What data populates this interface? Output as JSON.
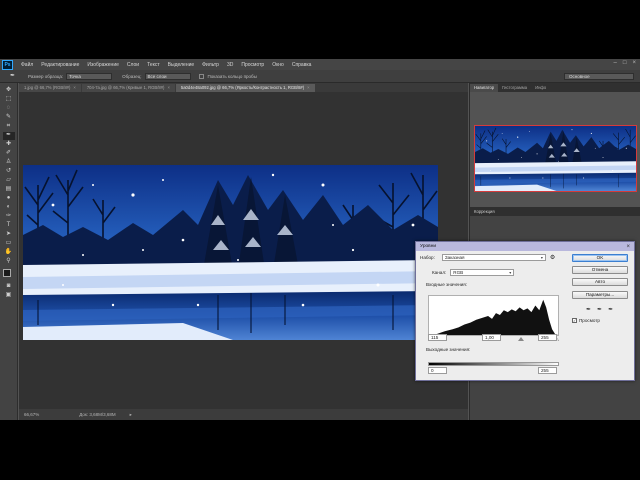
{
  "app": {
    "logo": "Ps"
  },
  "menu": [
    "Файл",
    "Редактирование",
    "Изображение",
    "Слои",
    "Текст",
    "Выделение",
    "Фильтр",
    "3D",
    "Просмотр",
    "Окно",
    "Справка"
  ],
  "options": {
    "tool_icon": "eyedropper-icon",
    "size_label": "Размер образца:",
    "size_value": "Точка",
    "sample_label": "Образец:",
    "sample_value": "Все слои",
    "ring_label": "Показать кольцо пробы",
    "workspace": "Основное"
  },
  "tabs": [
    {
      "label": "1.jpg @ 66,7% (RGB/8#)",
      "active": false
    },
    {
      "label": "704-7a.jpg @ 66,7% (Кривые 1, RGB/8#)",
      "active": false
    },
    {
      "label": "5a0d4e48a092.jpg @ 66,7% (Яркость/Контрастность 1, RGB/8#)",
      "active": true
    }
  ],
  "status": {
    "zoom": "66,67%",
    "doc": "Док: 3,68M/3,68M"
  },
  "panels": {
    "tabs": [
      "Навигатор",
      "Гистограмма",
      "Инфо"
    ],
    "correction_header": "Коррекция"
  },
  "levels": {
    "title": "Уровни",
    "preset_label": "Набор:",
    "preset_value": "Заказная",
    "channel_label": "Канал:",
    "channel_value": "RGB",
    "input_label": "Входные значения:",
    "input_black": "115",
    "input_gamma": "1,00",
    "input_white": "255",
    "output_label": "Выходные значения:",
    "output_black": "0",
    "output_white": "255",
    "buttons": {
      "ok": "OK",
      "cancel": "Отмена",
      "auto": "Авто",
      "params": "Параметры..."
    },
    "preview_label": "Просмотр",
    "preview_checked": true
  },
  "colors": {
    "app_bg": "#535353",
    "dialog_title_bg": "#b9b8dd",
    "navigator_frame": "#d53b3b"
  }
}
